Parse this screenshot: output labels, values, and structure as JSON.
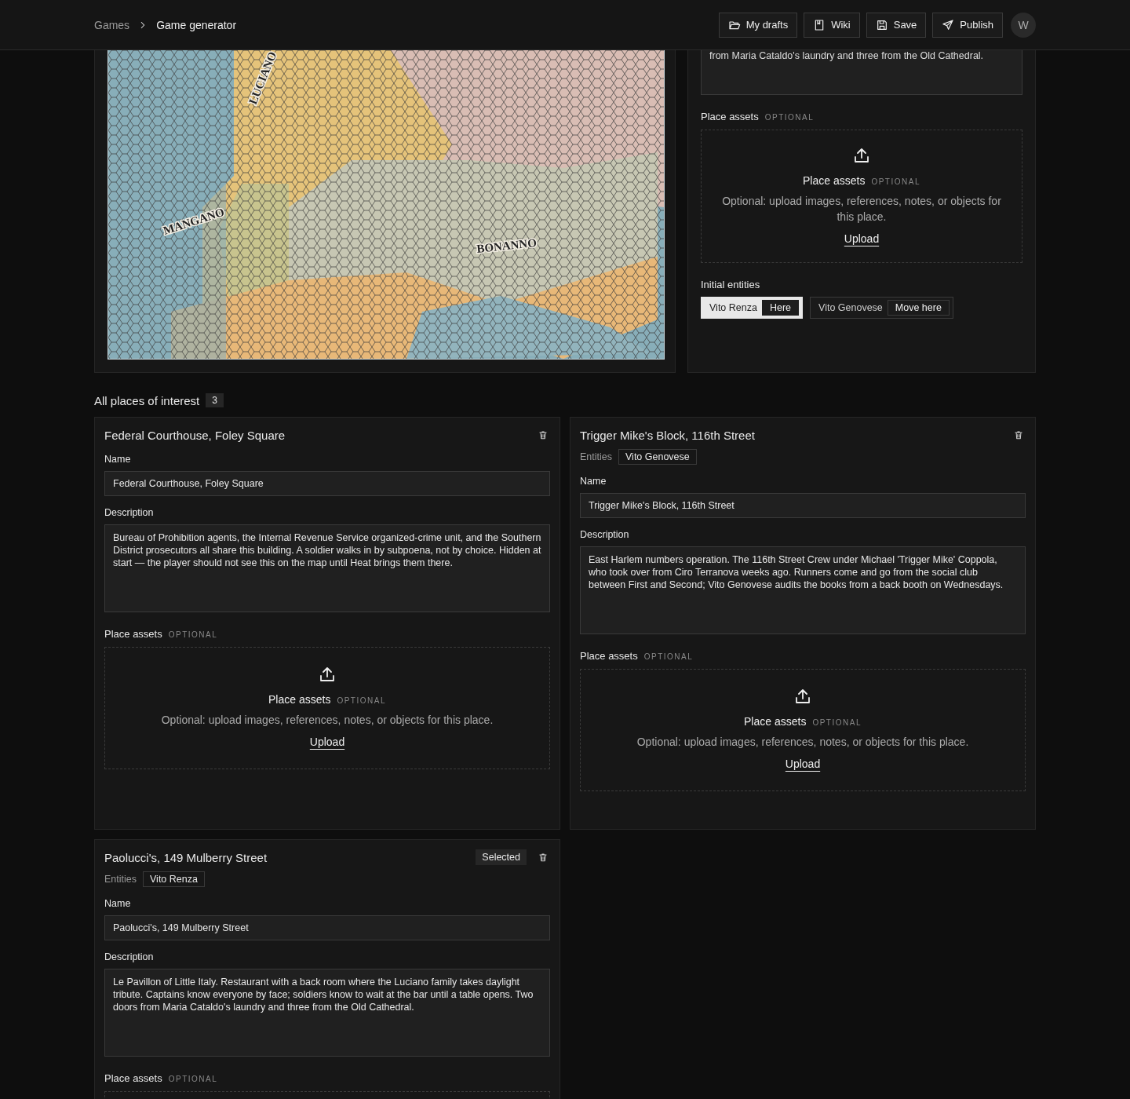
{
  "breadcrumb": [
    {
      "label": "Games",
      "current": false
    },
    {
      "label": "Game generator",
      "current": true
    }
  ],
  "actions": [
    {
      "kind": "drafts",
      "label": "My drafts"
    },
    {
      "kind": "wiki",
      "label": "Wiki"
    },
    {
      "kind": "save",
      "label": "Save"
    },
    {
      "kind": "publish",
      "label": "Publish"
    }
  ],
  "avatar": "W",
  "map": {
    "labels": [
      {
        "text": "LUCIANO"
      },
      {
        "text": "MANGANO"
      },
      {
        "text": "BONANNO"
      }
    ]
  },
  "editor": {
    "description_tail": "from Maria Cataldo's laundry and three from the Old Cathedral.",
    "assets_label": "Place assets",
    "optional": "OPTIONAL",
    "dropzone": {
      "title": "Place assets",
      "optional": "OPTIONAL",
      "text": "Optional: upload images, references, notes, or objects for this place.",
      "upload": "Upload"
    },
    "entities_label": "Initial entities",
    "entities": [
      {
        "name": "Vito Renza",
        "action": "Here",
        "selected": true
      },
      {
        "name": "Vito Genovese",
        "action": "Move here",
        "selected": false
      }
    ]
  },
  "places_heading": "All places of interest",
  "places_count": "3",
  "places": [
    {
      "title": "Federal Courthouse, Foley Square",
      "selected": false,
      "name_label": "Name",
      "name": "Federal Courthouse, Foley Square",
      "description_label": "Description",
      "description": "Bureau of Prohibition agents, the Internal Revenue Service organized-crime unit, and the Southern District prosecutors all share this building. A soldier walks in by subpoena, not by choice. Hidden at start — the player should not see this on the map until Heat brings them there.",
      "assets_label": "Place assets",
      "optional": "OPTIONAL",
      "dropzone": {
        "title": "Place assets",
        "optional": "OPTIONAL",
        "text": "Optional: upload images, references, notes, or objects for this place.",
        "upload": "Upload"
      }
    },
    {
      "title": "Trigger Mike's Block, 116th Street",
      "selected": false,
      "entities_label": "Entities",
      "entities": [
        "Vito Genovese"
      ],
      "name_label": "Name",
      "name": "Trigger Mike's Block, 116th Street",
      "description_label": "Description",
      "description": "East Harlem numbers operation. The 116th Street Crew under Michael 'Trigger Mike' Coppola, who took over from Ciro Terranova weeks ago. Runners come and go from the social club between First and Second; Vito Genovese audits the books from a back booth on Wednesdays.",
      "assets_label": "Place assets",
      "optional": "OPTIONAL",
      "dropzone": {
        "title": "Place assets",
        "optional": "OPTIONAL",
        "text": "Optional: upload images, references, notes, or objects for this place.",
        "upload": "Upload"
      }
    },
    {
      "title": "Paolucci's, 149 Mulberry Street",
      "selected": true,
      "selected_label": "Selected",
      "entities_label": "Entities",
      "entities": [
        "Vito Renza"
      ],
      "name_label": "Name",
      "name": "Paolucci's, 149 Mulberry Street",
      "description_label": "Description",
      "description": "Le Pavillon of Little Italy. Restaurant with a back room where the Luciano family takes daylight tribute. Captains know everyone by face; soldiers know to wait at the bar until a table opens. Two doors from Maria Cataldo's laundry and three from the Old Cathedral.",
      "assets_label": "Place assets",
      "optional": "OPTIONAL"
    }
  ]
}
